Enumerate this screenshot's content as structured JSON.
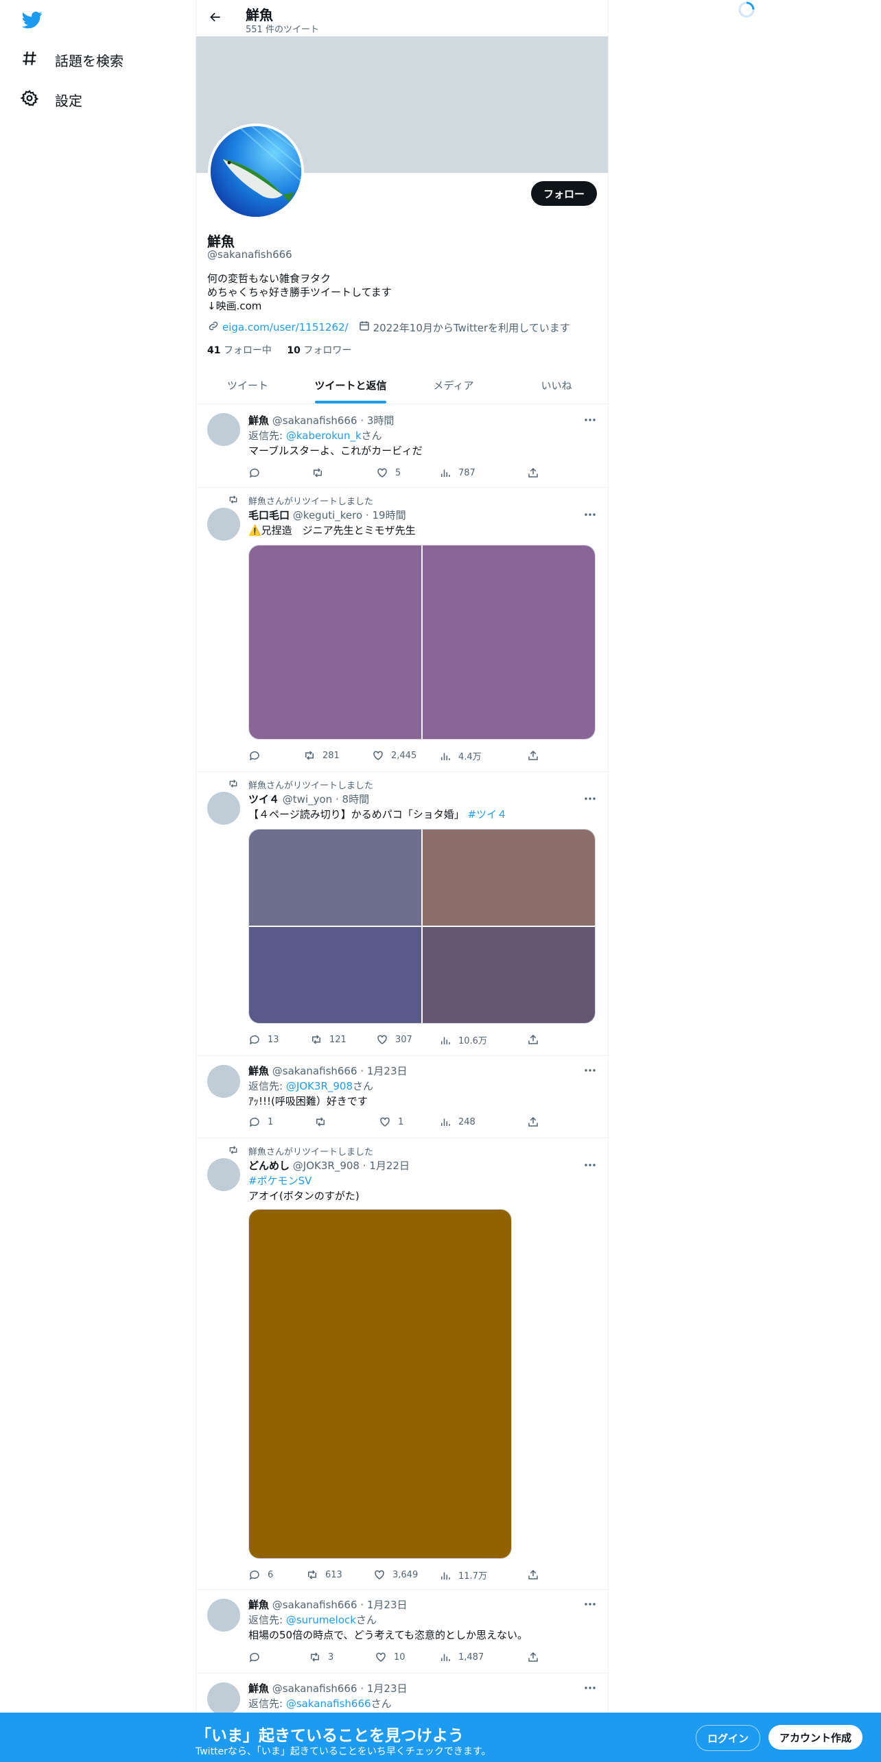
{
  "nav": {
    "explore_label": "話題を検索",
    "settings_label": "設定"
  },
  "header": {
    "name": "鮮魚",
    "tweet_count": "551 件のツイート"
  },
  "profile": {
    "follow_label": "フォロー",
    "name": "鮮魚",
    "handle": "@sakanafish666",
    "bio_lines": [
      "何の変哲もない雑食ヲタク",
      "めちゃくちゃ好き勝手ツイートしてます",
      "↓映画.com"
    ],
    "link": "eiga.com/user/1151262/",
    "joined": "2022年10月からTwitterを利用しています",
    "following_count": "41",
    "following_label": "フォロー中",
    "followers_count": "10",
    "followers_label": "フォロワー"
  },
  "tabs": [
    "ツイート",
    "ツイートと返信",
    "メディア",
    "いいね"
  ],
  "tweets": [
    {
      "name": "鮮魚",
      "handle": "@sakanafish666",
      "sep": "·",
      "time": "3時間",
      "reply_prefix": "返信先: ",
      "reply_to": "@kaberokun_k",
      "reply_suffix": "さん",
      "text": "マーブルスターよ、これがカービィだ",
      "replies": "",
      "retweets": "",
      "likes": "5",
      "views": "787"
    },
    {
      "retweeted_by": "鮮魚さんがリツイートしました",
      "name": "毛口毛口",
      "handle": "@keguti_kero",
      "sep": "·",
      "time": "19時間",
      "text": "⚠️兄捏造　ジニア先生とミモザ先生",
      "media_colors": [
        "#8a6598",
        "#8a6598"
      ],
      "replies": "",
      "retweets": "281",
      "likes": "2,445",
      "views": "4.4万"
    },
    {
      "retweeted_by": "鮮魚さんがリツイートしました",
      "name": "ツイ４",
      "handle": "@twi_yon",
      "sep": "·",
      "time": "8時間",
      "text": "【４ページ読み切り】かるめパコ「ショタ婚」",
      "hashtag": "#ツイ４",
      "media_colors": [
        "#6e6e8e",
        "#8c6e6a",
        "#5a5a8a",
        "#655672"
      ],
      "replies": "13",
      "retweets": "121",
      "likes": "307",
      "views": "10.6万"
    },
    {
      "name": "鮮魚",
      "handle": "@sakanafish666",
      "sep": "·",
      "time": "1月23日",
      "reply_prefix": "返信先: ",
      "reply_to": "@JOK3R_908",
      "reply_suffix": "さん",
      "text": "ｱｯ!!!(呼吸困難）好きです",
      "replies": "1",
      "retweets": "",
      "likes": "1",
      "views": "248"
    },
    {
      "retweeted_by": "鮮魚さんがリツイートしました",
      "name": "どんめし",
      "handle": "@JOK3R_908",
      "sep": "·",
      "time": "1月22日",
      "hashtag": "#ポケモンSV",
      "text": "アオイ(ボタンのすがた)",
      "media_colors": [
        "#926200"
      ],
      "replies": "6",
      "retweets": "613",
      "likes": "3,649",
      "views": "11.7万"
    },
    {
      "name": "鮮魚",
      "handle": "@sakanafish666",
      "sep": "·",
      "time": "1月23日",
      "reply_prefix": "返信先: ",
      "reply_to": "@surumelock",
      "reply_suffix": "さん",
      "text": "相場の50倍の時点で、どう考えても恣意的としか思えない。",
      "replies": "",
      "retweets": "3",
      "likes": "10",
      "views": "1,487"
    },
    {
      "name": "鮮魚",
      "handle": "@sakanafish666",
      "sep": "·",
      "time": "1月23日",
      "reply_prefix": "返信先: ",
      "reply_to": "@sakanafish666",
      "reply_suffix": "さん"
    }
  ],
  "bottom_bar": {
    "title": "「いま」起きていることを見つけよう",
    "subtitle": "Twitterなら、「いま」起きていることをいち早くチェックできます。",
    "login_label": "ログイン",
    "signup_label": "アカウント作成"
  },
  "colors": {
    "accent": "#1d9bf0",
    "text": "#0f1419",
    "muted": "#536471",
    "banner": "#cfd9de"
  },
  "icons": [
    "twitter-bird-icon",
    "hashtag-icon",
    "gear-icon",
    "back-arrow-icon",
    "link-icon",
    "calendar-icon",
    "retweet-icon",
    "reply-icon",
    "like-icon",
    "views-icon",
    "share-icon",
    "more-icon",
    "loading-spinner-icon"
  ]
}
